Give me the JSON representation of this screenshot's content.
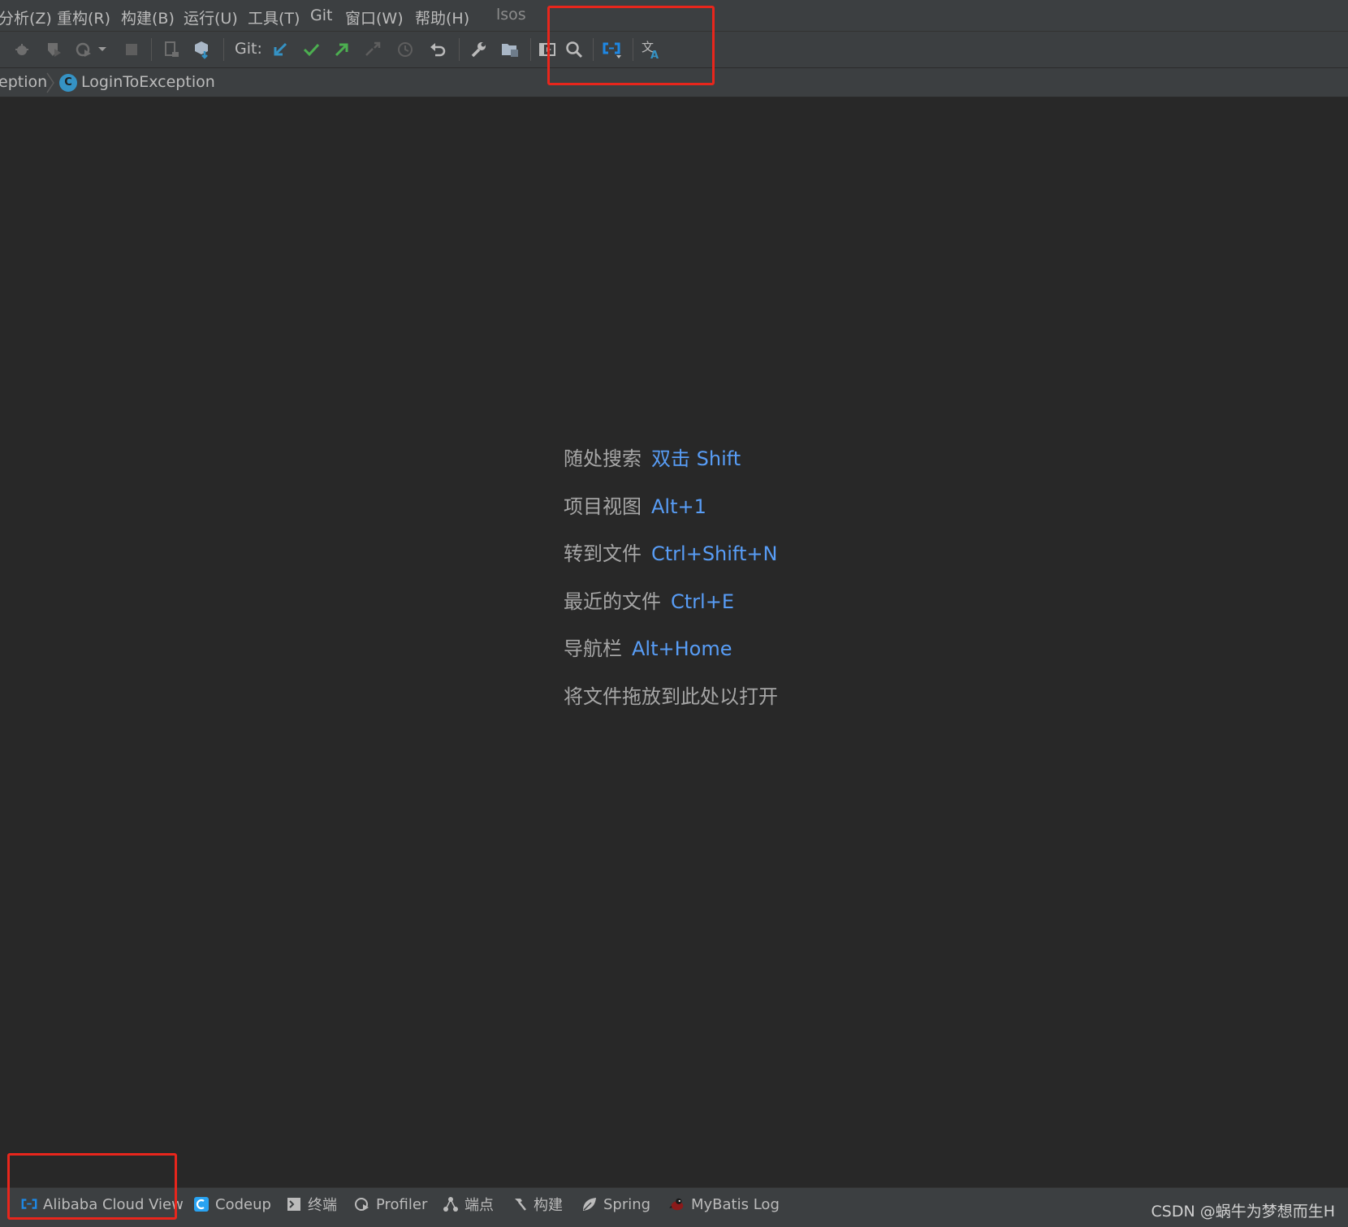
{
  "menu": {
    "items": [
      "分析(Z)",
      "重构(R)",
      "构建(B)",
      "运行(U)",
      "工具(T)",
      "Git",
      "窗口(W)",
      "帮助(H)"
    ],
    "project_title": "lsos"
  },
  "toolbar": {
    "git_label": "Git:",
    "icons": [
      "debug-icon",
      "coverage-icon",
      "profile-icon",
      "dropdown-icon",
      "stop-icon",
      "device-icon",
      "build-artifact-icon",
      "git-update-icon",
      "git-commit-icon",
      "git-push-icon",
      "git-compare-icon",
      "history-icon",
      "rollback-icon",
      "settings-wrench-icon",
      "project-structure-icon",
      "presentation-icon",
      "search-icon",
      "alibaba-cloud-icon",
      "translate-icon"
    ]
  },
  "breadcrumb": {
    "parent": "eption",
    "current": "LoginToException",
    "class_badge": "C"
  },
  "editor": {
    "hints": [
      {
        "label": "随处搜索",
        "key": "双击 Shift"
      },
      {
        "label": "项目视图",
        "key": "Alt+1"
      },
      {
        "label": "转到文件",
        "key": "Ctrl+Shift+N"
      },
      {
        "label": "最近的文件",
        "key": "Ctrl+E"
      },
      {
        "label": "导航栏",
        "key": "Alt+Home"
      },
      {
        "label": "将文件拖放到此处以打开",
        "key": ""
      }
    ]
  },
  "bottombar": {
    "items": [
      {
        "label": "Alibaba Cloud View",
        "icon": "alibaba-cloud-icon"
      },
      {
        "label": "Codeup",
        "icon": "codeup-icon"
      },
      {
        "label": "终端",
        "icon": "terminal-icon"
      },
      {
        "label": "Profiler",
        "icon": "profiler-icon"
      },
      {
        "label": "端点",
        "icon": "endpoints-icon"
      },
      {
        "label": "构建",
        "icon": "hammer-icon"
      },
      {
        "label": "Spring",
        "icon": "spring-leaf-icon"
      },
      {
        "label": "MyBatis Log",
        "icon": "mybatis-bird-icon"
      }
    ]
  },
  "watermark": "CSDN @蜗牛为梦想而生H",
  "colors": {
    "background": "#2b2b2b",
    "toolbar": "#3c3f41",
    "shortcut_blue": "#589df6",
    "annotation_red": "#e8261c"
  }
}
